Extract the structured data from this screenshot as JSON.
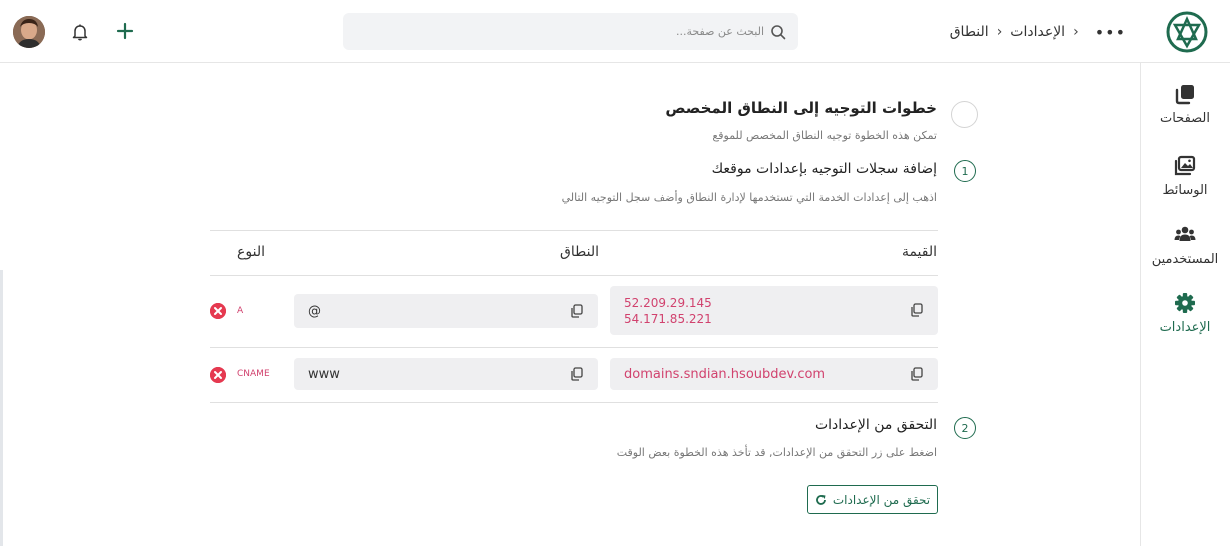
{
  "header": {
    "breadcrumb": [
      "الإعدادات",
      "النطاق"
    ],
    "more_label": "•••",
    "search_placeholder": "البحث عن صفحة..."
  },
  "sidebar": {
    "items": [
      {
        "label": "الصفحات",
        "icon": "pages-icon",
        "active": false
      },
      {
        "label": "الوسائط",
        "icon": "media-icon",
        "active": false
      },
      {
        "label": "المستخدمين",
        "icon": "users-icon",
        "active": false
      },
      {
        "label": "الإعدادات",
        "icon": "gear-icon",
        "active": true
      }
    ]
  },
  "steps": {
    "intro": {
      "title": "خطوات التوجيه إلى النطاق المخصص",
      "subtitle": "تمكن هذه الخطوة توجيه النطاق المخصص للموقع"
    },
    "step1": {
      "number": "1",
      "title": "إضافة سجلات التوجيه بإعدادات موقعك",
      "subtitle": "اذهب إلى إعدادات الخدمة التي تستخدمها لإدارة النطاق وأضف سجل التوجيه التالي"
    },
    "step2": {
      "number": "2",
      "title": "التحقق من الإعدادات",
      "subtitle": "اضغط على زر التحقق من الإعدادات, قد تأخذ هذه الخطوة بعض الوقت",
      "button_label": "تحقق من الإعدادات"
    }
  },
  "records_table": {
    "headers": {
      "value": "القيمة",
      "domain": "النطاق",
      "type": "النوع"
    },
    "rows": [
      {
        "value_lines": [
          "52.209.29.145",
          "54.171.85.221"
        ],
        "domain": "@",
        "type": "A"
      },
      {
        "value_lines": [
          "domains.sndian.hsoubdev.com"
        ],
        "domain": "www",
        "type": "CNAME"
      }
    ]
  },
  "colors": {
    "accent": "#1f6b4f",
    "record_value": "#d1426e",
    "delete": "#e53950"
  }
}
